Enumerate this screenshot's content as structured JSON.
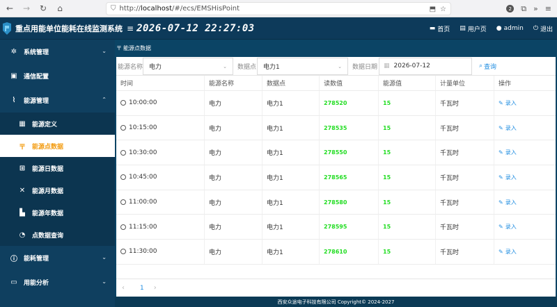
{
  "browser": {
    "url_prefix": "http://",
    "url_host": "localhost",
    "url_path": "/#/ecs/EMSHisPoint",
    "badge_count": "2"
  },
  "header": {
    "title": "重点用能单位能耗在线监测系统",
    "clock": "2026-07-12 22:27:03",
    "home": "首页",
    "user_page": "用户页",
    "user": "admin",
    "logout": "退出"
  },
  "sidebar": {
    "items": [
      {
        "label": "系统管理",
        "icon": "gear-icon"
      },
      {
        "label": "通信配置",
        "icon": "chip-icon"
      },
      {
        "label": "能源管理",
        "icon": "paperclip-icon"
      },
      {
        "label": "能源定义",
        "icon": "list-icon"
      },
      {
        "label": "能源点数据",
        "icon": "point-data-icon"
      },
      {
        "label": "能源日数据",
        "icon": "day-data-icon"
      },
      {
        "label": "能源月数据",
        "icon": "month-data-icon"
      },
      {
        "label": "能源年数据",
        "icon": "year-data-icon"
      },
      {
        "label": "点数据查询",
        "icon": "query-icon"
      },
      {
        "label": "能耗管理",
        "icon": "consumption-icon"
      },
      {
        "label": "用能分析",
        "icon": "analysis-icon"
      }
    ]
  },
  "breadcrumb": "能源点数据",
  "filters": {
    "energy_name_label": "能源名称",
    "energy_name_value": "电力",
    "point_label": "数据点",
    "point_value": "电力1",
    "date_label": "数据日期",
    "date_value": "2026-07-12",
    "query_label": "查询"
  },
  "table": {
    "headers": [
      "时间",
      "能源名称",
      "数据点",
      "读数值",
      "能源值",
      "计量单位",
      "操作"
    ],
    "rows": [
      {
        "time": "10:00:00",
        "name": "电力",
        "point": "电力1",
        "reading": "278520",
        "value": "15",
        "unit": "千瓦时",
        "action": "录入"
      },
      {
        "time": "10:15:00",
        "name": "电力",
        "point": "电力1",
        "reading": "278535",
        "value": "15",
        "unit": "千瓦时",
        "action": "录入"
      },
      {
        "time": "10:30:00",
        "name": "电力",
        "point": "电力1",
        "reading": "278550",
        "value": "15",
        "unit": "千瓦时",
        "action": "录入"
      },
      {
        "time": "10:45:00",
        "name": "电力",
        "point": "电力1",
        "reading": "278565",
        "value": "15",
        "unit": "千瓦时",
        "action": "录入"
      },
      {
        "time": "11:00:00",
        "name": "电力",
        "point": "电力1",
        "reading": "278580",
        "value": "15",
        "unit": "千瓦时",
        "action": "录入"
      },
      {
        "time": "11:15:00",
        "name": "电力",
        "point": "电力1",
        "reading": "278595",
        "value": "15",
        "unit": "千瓦时",
        "action": "录入"
      },
      {
        "time": "11:30:00",
        "name": "电力",
        "point": "电力1",
        "reading": "278610",
        "value": "15",
        "unit": "千瓦时",
        "action": "录入"
      }
    ]
  },
  "pager": {
    "current": "1",
    "prev": "‹",
    "next": "›"
  },
  "footer": "西安众途电子科技有限公司 Copyright© 2024-2027",
  "colors": {
    "accent": "#1e8ce0",
    "active": "#f39c12",
    "reading": "#22dd22",
    "sidebar": "#0f3f5f"
  }
}
